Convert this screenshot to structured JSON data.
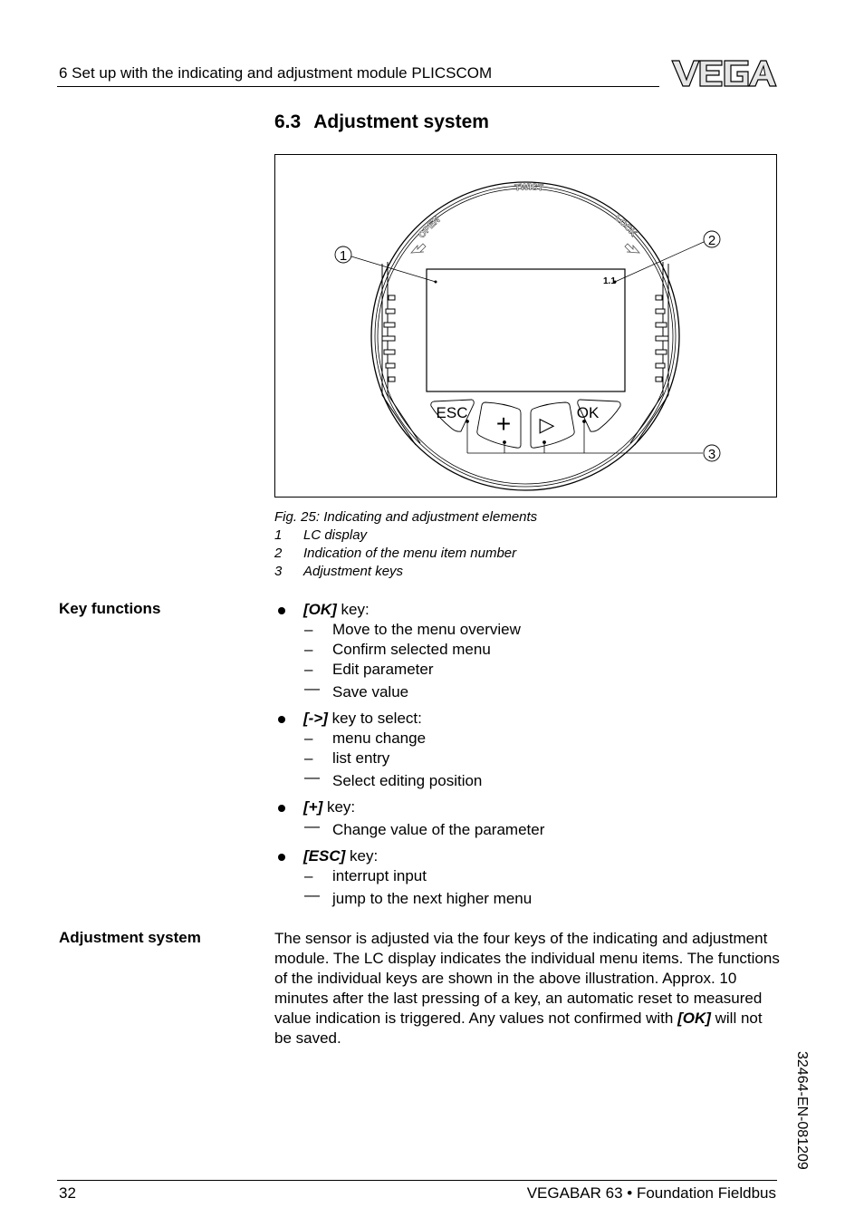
{
  "header": {
    "chapter": "6   Set up with the indicating and adjustment module PLICSCOM",
    "logo_text": "VEGA"
  },
  "section": {
    "number": "6.3",
    "title": "Adjustment system"
  },
  "figure": {
    "labels": {
      "twist": "TWIST",
      "open": "OPEN",
      "lock": "LOCK",
      "menu_item_number": "1.1"
    },
    "keys": [
      {
        "name": "esc",
        "label": "ESC"
      },
      {
        "name": "plus",
        "label": "+"
      },
      {
        "name": "arrow",
        "label": "▷"
      },
      {
        "name": "ok",
        "label": "OK"
      }
    ],
    "callouts": [
      "1",
      "2",
      "3"
    ],
    "caption": "Fig. 25: Indicating and adjustment elements",
    "legend": [
      {
        "num": "1",
        "text": "LC display"
      },
      {
        "num": "2",
        "text": "Indication of the menu item number"
      },
      {
        "num": "3",
        "text": "Adjustment keys"
      }
    ]
  },
  "key_functions": {
    "side_label": "Key functions",
    "items": [
      {
        "key": "[OK]",
        "suffix": " key:",
        "subs": [
          "Move to the menu overview",
          "Confirm selected menu",
          "Edit parameter",
          "Save value"
        ]
      },
      {
        "key": "[->]",
        "suffix": " key to select:",
        "subs": [
          "menu change",
          "list entry",
          "Select editing position"
        ]
      },
      {
        "key": "[+]",
        "suffix": " key:",
        "subs": [
          "Change value of the parameter"
        ]
      },
      {
        "key": "[ESC]",
        "suffix": " key:",
        "subs": [
          "interrupt input",
          "jump to the next higher menu"
        ]
      }
    ]
  },
  "adjustment_system": {
    "side_label": "Adjustment system",
    "text_before": "The sensor is adjusted via the four keys of the indicating and adjustment module. The LC display indicates the individual menu items. The functions of the individual keys are shown in the above illustration. Approx. 10 minutes after the last pressing of a key, an automatic reset to measured value indication is triggered. Any values not confirmed with ",
    "key": "[OK]",
    "text_after": " will not be saved."
  },
  "doc_number": "32464-EN-081209",
  "footer": {
    "page": "32",
    "product": "VEGABAR 63 • Foundation Fieldbus"
  }
}
